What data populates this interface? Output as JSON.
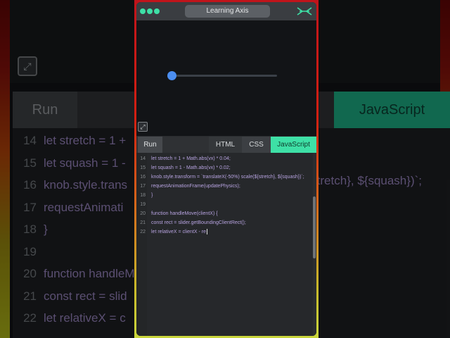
{
  "window": {
    "title": "Learning Axis",
    "logo_icon": "crossed-arrows-logo",
    "traffic_lights": [
      "dot-1",
      "dot-2",
      "dot-3"
    ],
    "accent": "#3ee0a6"
  },
  "preview": {
    "slider_value": 0.0,
    "expand_icon": "expand-icon"
  },
  "tabs": {
    "run": "Run",
    "html": "HTML",
    "css": "CSS",
    "js": "JavaScript",
    "active": "JavaScript"
  },
  "code": {
    "lines": [
      {
        "n": "14",
        "text": "let stretch = 1 + Math.abs(vx) * 0.04;"
      },
      {
        "n": "15",
        "text": "let squash = 1 - Math.abs(vx) * 0.02;"
      },
      {
        "n": "16",
        "text": "knob.style.transform = `translateX(-50%) scale(${stretch}, ${squash})`;"
      },
      {
        "n": "17",
        "text": "requestAnimationFrame(updatePhysics);"
      },
      {
        "n": "18",
        "text": "}"
      },
      {
        "n": "19",
        "text": ""
      },
      {
        "n": "20",
        "text": "function handleMove(clientX) {"
      },
      {
        "n": "21",
        "text": "const rect = slider.getBoundingClientRect();"
      },
      {
        "n": "22",
        "text": "let relativeX = clientX - re"
      }
    ]
  },
  "background": {
    "run": "Run",
    "js": "JavaScript",
    "lines": [
      {
        "n": "14",
        "text": "let stretch = 1 +"
      },
      {
        "n": "15",
        "text": "let squash = 1 -"
      },
      {
        "n": "16",
        "text": "knob.style.trans"
      },
      {
        "n": "17",
        "text": "requestAnimati"
      },
      {
        "n": "18",
        "text": "}"
      },
      {
        "n": "19",
        "text": ""
      },
      {
        "n": "20",
        "text": "function handleM"
      },
      {
        "n": "21",
        "text": "const rect = slid"
      },
      {
        "n": "22",
        "text": "let relativeX = c"
      }
    ],
    "right_text": "tretch}, ${squash})`;"
  }
}
